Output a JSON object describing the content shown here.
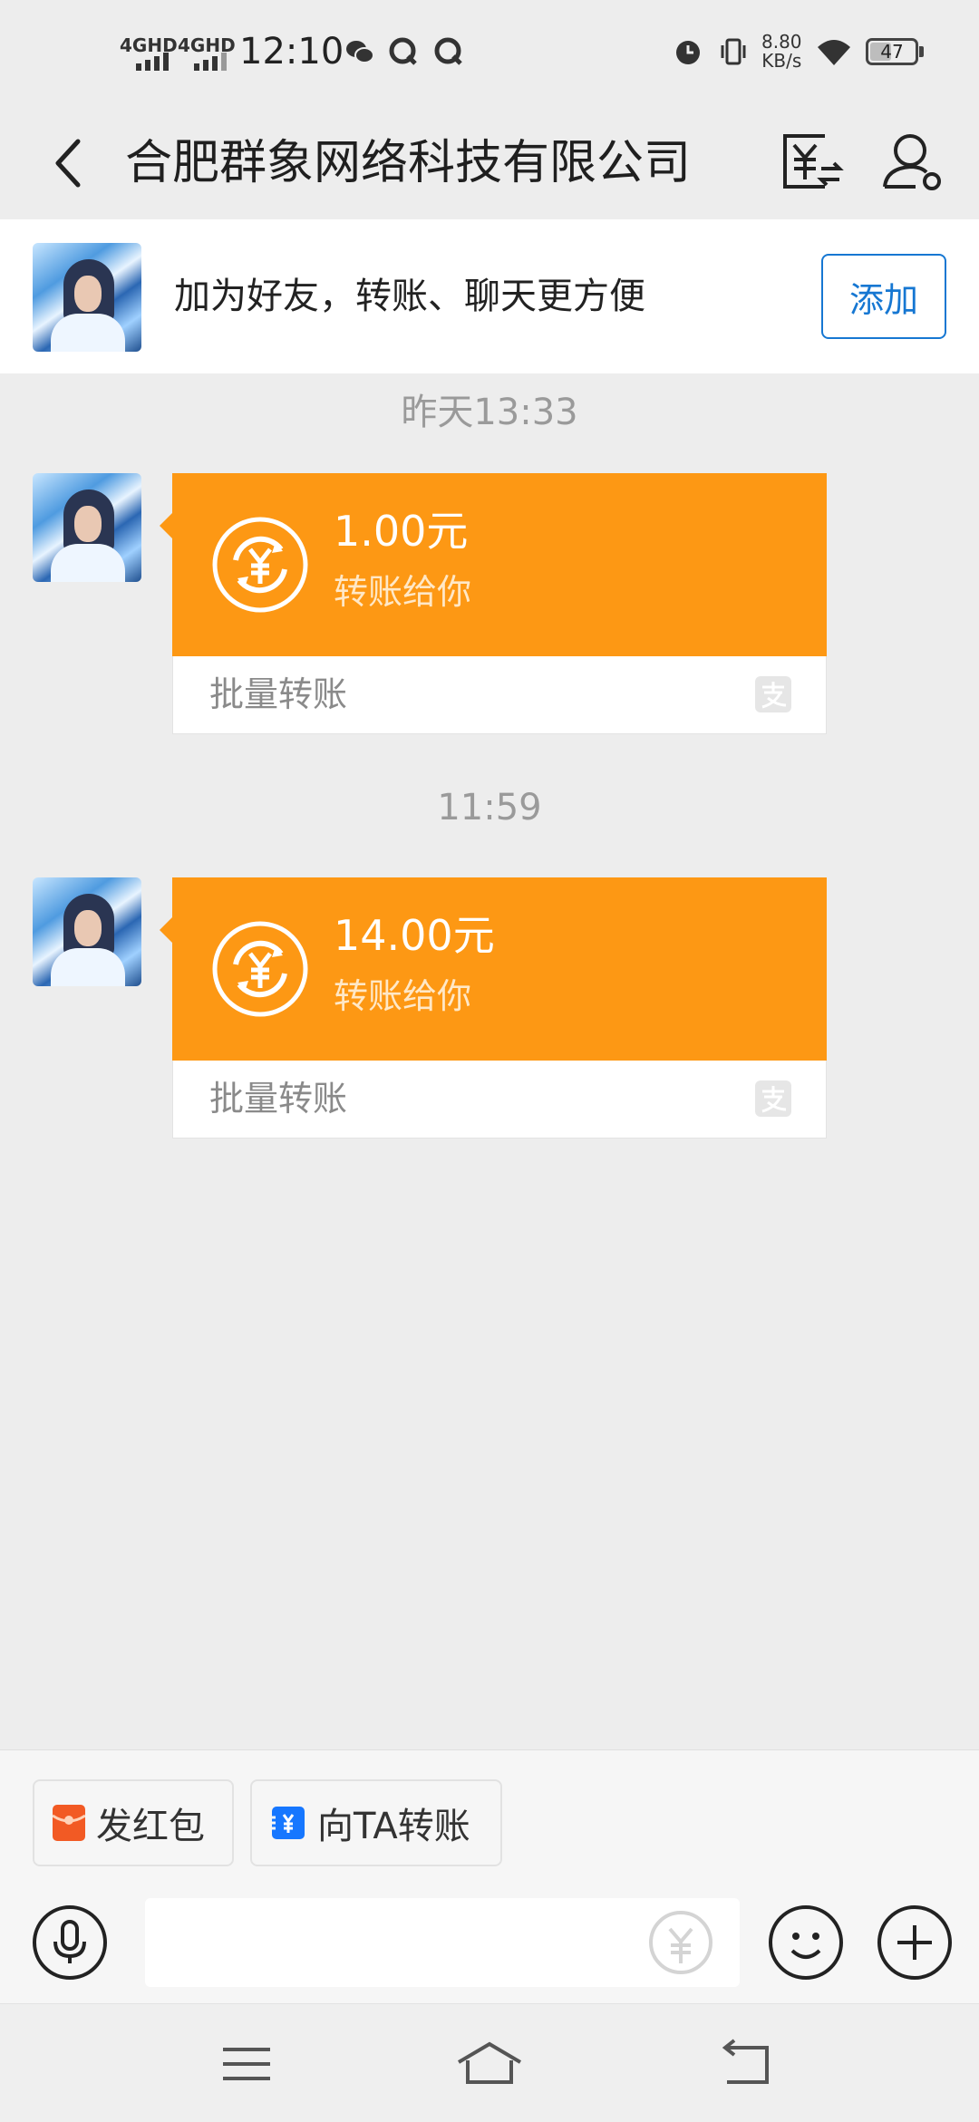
{
  "status_bar": {
    "net1": "4GHD",
    "net2": "4GHD",
    "time": "12:10",
    "speed_value": "8.80",
    "speed_unit": "KB/s",
    "battery": "47",
    "battery_level": 0.47
  },
  "header": {
    "title": "合肥群象网络科技有限公司"
  },
  "banner": {
    "text": "加为好友，转账、聊天更方便",
    "add_label": "添加"
  },
  "messages": [
    {
      "time": "昨天13:33",
      "amount": "1.00元",
      "subtitle": "转账给你",
      "type": "批量转账"
    },
    {
      "time": "11:59",
      "amount": "14.00元",
      "subtitle": "转账给你",
      "type": "批量转账"
    }
  ],
  "quick_actions": {
    "red_packet": "发红包",
    "transfer": "向TA转账"
  },
  "colors": {
    "card_orange": "#fd9814",
    "accent_blue": "#1677d2",
    "red_packet": "#f25a24"
  }
}
